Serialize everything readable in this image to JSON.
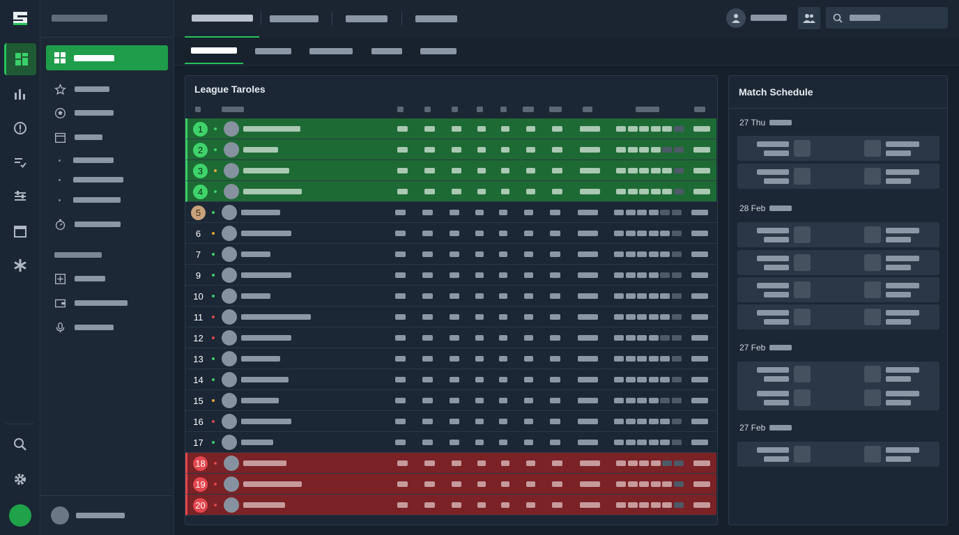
{
  "table": {
    "title": "League Taroles",
    "rows": [
      {
        "pos": "1",
        "zone": "promo",
        "badge": "g",
        "dot": "#3ad16a"
      },
      {
        "pos": "2",
        "zone": "promo",
        "badge": "g",
        "dot": "#3ad16a"
      },
      {
        "pos": "3",
        "zone": "promo",
        "badge": "g",
        "dot": "#e7a53a"
      },
      {
        "pos": "4",
        "zone": "promo",
        "badge": "g",
        "dot": "#3ad16a"
      },
      {
        "pos": "5",
        "zone": "",
        "badge": "t",
        "dot": "#3ad16a"
      },
      {
        "pos": "6",
        "zone": "",
        "badge": "",
        "dot": "#e7a53a"
      },
      {
        "pos": "7",
        "zone": "",
        "badge": "",
        "dot": "#3ad16a"
      },
      {
        "pos": "9",
        "zone": "",
        "badge": "",
        "dot": "#3ad16a"
      },
      {
        "pos": "10",
        "zone": "",
        "badge": "",
        "dot": "#3ad16a"
      },
      {
        "pos": "11",
        "zone": "",
        "badge": "",
        "dot": "#e0474d"
      },
      {
        "pos": "12",
        "zone": "",
        "badge": "",
        "dot": "#e0474d"
      },
      {
        "pos": "13",
        "zone": "",
        "badge": "",
        "dot": "#3ad16a"
      },
      {
        "pos": "14",
        "zone": "",
        "badge": "",
        "dot": "#3ad16a"
      },
      {
        "pos": "15",
        "zone": "",
        "badge": "",
        "dot": "#e7a53a"
      },
      {
        "pos": "16",
        "zone": "",
        "badge": "",
        "dot": "#e0474d"
      },
      {
        "pos": "17",
        "zone": "",
        "badge": "",
        "dot": "#3ad16a"
      },
      {
        "pos": "18",
        "zone": "releg",
        "badge": "r",
        "dot": "#e0474d"
      },
      {
        "pos": "19",
        "zone": "releg",
        "badge": "r",
        "dot": "#e0474d"
      },
      {
        "pos": "20",
        "zone": "releg",
        "badge": "r",
        "dot": "#e0474d"
      }
    ]
  },
  "schedule": {
    "title": "Match Schedule",
    "dates": [
      "27 Thu",
      "28 Feb",
      "27 Feb",
      "27 Feb"
    ]
  },
  "colors": {
    "accent": "#27c25a",
    "promotion": "#1e6a34",
    "relegation": "#7a2226",
    "background": "#15202b"
  },
  "icons": [
    "logo-icon",
    "dashboard-icon",
    "bar-chart-icon",
    "info-icon",
    "checklist-icon",
    "sliders-icon",
    "calendar-icon",
    "asterisk-icon",
    "search-icon",
    "gear-icon",
    "star-icon",
    "football-icon",
    "timer-icon",
    "plus-box-icon",
    "wallet-icon",
    "microphone-icon",
    "user-icon",
    "users-icon"
  ]
}
